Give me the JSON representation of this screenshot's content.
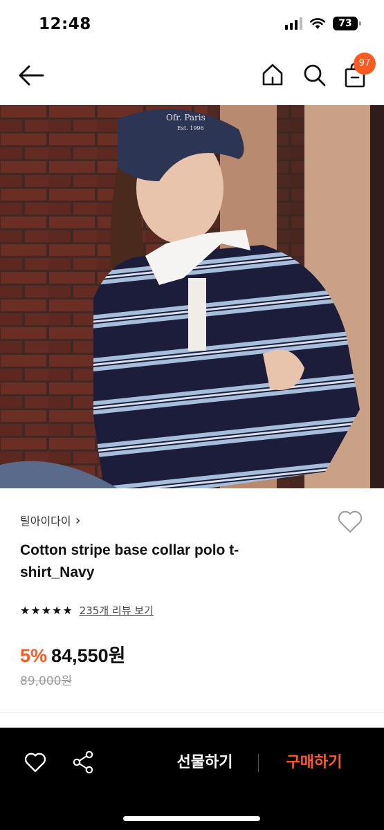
{
  "status_bar": {
    "time": "12:48",
    "battery": "73"
  },
  "nav": {
    "cart_count": "97"
  },
  "product": {
    "brand": "틸아이다이",
    "brand_chevron": "›",
    "name": "Cotton stripe base collar polo t-shirt_Navy",
    "rating_stars": [
      "★",
      "★",
      "★",
      "★",
      "★"
    ],
    "review_link": "235개 리뷰 보기",
    "discount": "5%",
    "price": "84,550원",
    "original_price": "89,000원",
    "hero_cap_text": "Ofr. Paris",
    "hero_cap_subtext": "Est. 1996"
  },
  "bottom_bar": {
    "gift_label": "선물하기",
    "buy_label": "구매하기"
  },
  "colors": {
    "accent": "#ff5a1f",
    "bottom_bar": "#000000",
    "navy": "#1b1d3a",
    "stripe_blue": "#a7bedb"
  },
  "icons": [
    "back-arrow-icon",
    "home-icon",
    "search-icon",
    "shopping-bag-icon",
    "heart-icon",
    "share-icon",
    "chevron-right-icon",
    "star-icon",
    "wifi-icon",
    "signal-icon",
    "battery-icon"
  ]
}
